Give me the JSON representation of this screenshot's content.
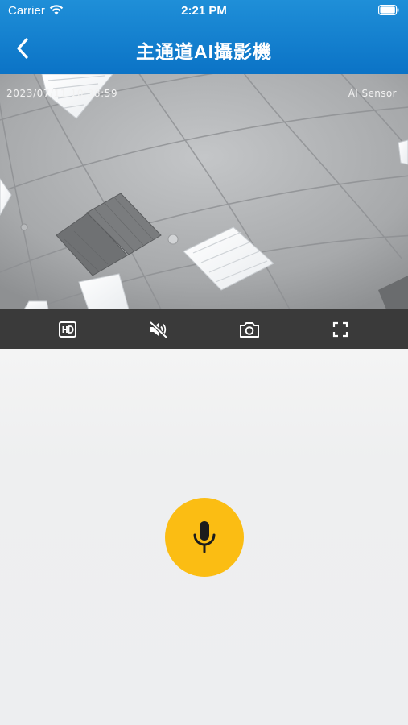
{
  "status_bar": {
    "carrier": "Carrier",
    "time": "2:21 PM"
  },
  "nav": {
    "title": "主通道AI攝影機",
    "back_icon": "chevron-left-icon"
  },
  "video": {
    "timestamp": "2023/07/11 10:38:59",
    "sensor_label": "AI Sensor"
  },
  "controls": [
    {
      "icon": "hd-icon"
    },
    {
      "icon": "volume-muted-icon"
    },
    {
      "icon": "camera-snapshot-icon"
    },
    {
      "icon": "fullscreen-icon"
    }
  ],
  "talk": {
    "icon": "microphone-icon",
    "color": "#fbbd13"
  },
  "colors": {
    "nav_bg": "#0b73c6",
    "control_bar": "#3a3a3a",
    "background": "#eeeff0"
  }
}
